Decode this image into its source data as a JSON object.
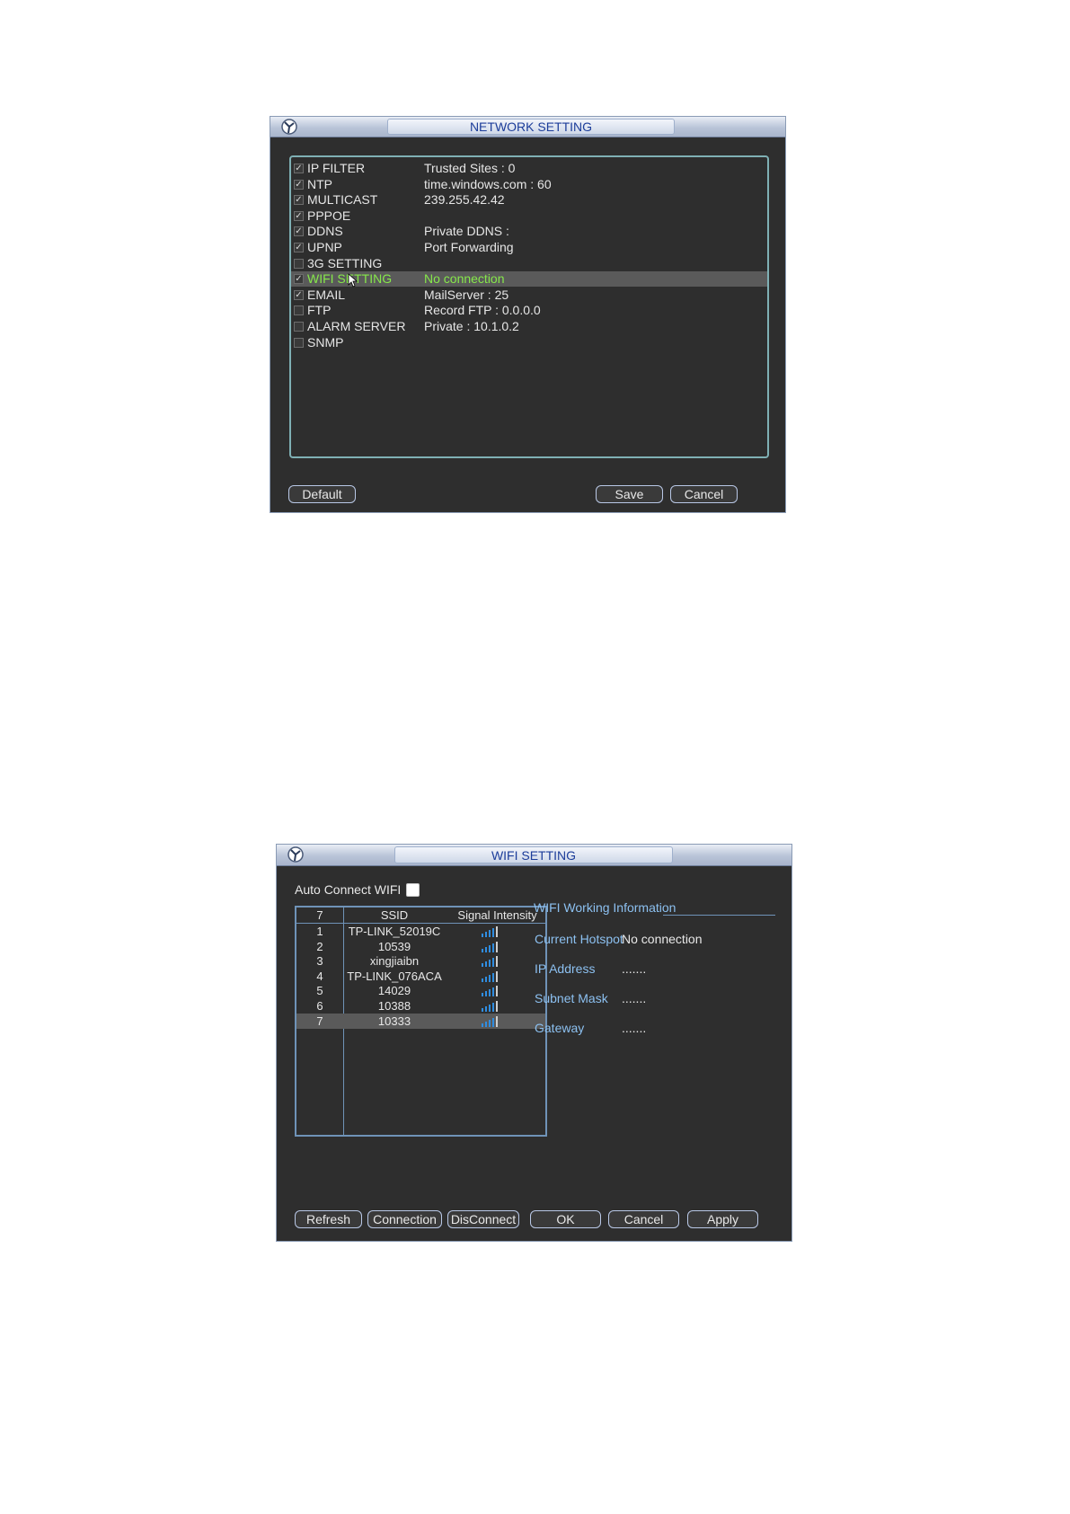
{
  "network_window": {
    "title": "NETWORK SETTING",
    "items": [
      {
        "name": "IP FILTER",
        "value": "Trusted Sites : 0",
        "checked": true,
        "selected": false
      },
      {
        "name": "NTP",
        "value": "time.windows.com : 60",
        "checked": true,
        "selected": false
      },
      {
        "name": "MULTICAST",
        "value": "239.255.42.42",
        "checked": true,
        "selected": false
      },
      {
        "name": "PPPOE",
        "value": "",
        "checked": true,
        "selected": false
      },
      {
        "name": "DDNS",
        "value": "Private DDNS :",
        "checked": true,
        "selected": false
      },
      {
        "name": "UPNP",
        "value": "Port Forwarding",
        "checked": true,
        "selected": false
      },
      {
        "name": "3G SETTING",
        "value": "",
        "checked": false,
        "selected": false
      },
      {
        "name": "WIFI SETTING",
        "value": "No connection",
        "checked": true,
        "selected": true
      },
      {
        "name": "EMAIL",
        "value": "MailServer : 25",
        "checked": true,
        "selected": false
      },
      {
        "name": "FTP",
        "value": "Record FTP : 0.0.0.0",
        "checked": false,
        "selected": false
      },
      {
        "name": "ALARM SERVER",
        "value": "Private : 10.1.0.2",
        "checked": false,
        "selected": false
      },
      {
        "name": "SNMP",
        "value": "",
        "checked": false,
        "selected": false
      }
    ],
    "buttons": {
      "default": "Default",
      "save": "Save",
      "cancel": "Cancel"
    }
  },
  "wifi_window": {
    "title": "WIFI SETTING",
    "auto_connect_label": "Auto Connect WIFI",
    "auto_connect_checked": false,
    "table": {
      "headers": {
        "count": "7",
        "ssid": "SSID",
        "signal": "Signal Intensity"
      },
      "rows": [
        {
          "index": "1",
          "ssid": "TP-LINK_52019C",
          "signal_level": 4,
          "selected": false
        },
        {
          "index": "2",
          "ssid": "10539",
          "signal_level": 4,
          "selected": false
        },
        {
          "index": "3",
          "ssid": "xingjiaibn",
          "signal_level": 4,
          "selected": false
        },
        {
          "index": "4",
          "ssid": "TP-LINK_076ACA",
          "signal_level": 4,
          "selected": false
        },
        {
          "index": "5",
          "ssid": "14029",
          "signal_level": 4,
          "selected": false
        },
        {
          "index": "6",
          "ssid": "10388",
          "signal_level": 4,
          "selected": false
        },
        {
          "index": "7",
          "ssid": "10333",
          "signal_level": 4,
          "selected": true
        }
      ]
    },
    "info": {
      "heading": "WIFI Working Information",
      "current_hotspot_label": "Current Hotspot",
      "current_hotspot_value": "No connection",
      "ip_label": "IP Address",
      "ip_value": ".......",
      "subnet_label": "Subnet Mask",
      "subnet_value": ".......",
      "gateway_label": "Gateway",
      "gateway_value": "......."
    },
    "buttons": {
      "refresh": "Refresh",
      "connection": "Connection",
      "disconnect": "DisConnect",
      "ok": "OK",
      "cancel": "Cancel",
      "apply": "Apply"
    }
  },
  "colors": {
    "panel_bg": "#2e2e2e",
    "title_text": "#1c3d9a",
    "selected_text": "#86e84a",
    "info_label": "#8cc0f0",
    "signal_bar": "#2f8de0"
  }
}
